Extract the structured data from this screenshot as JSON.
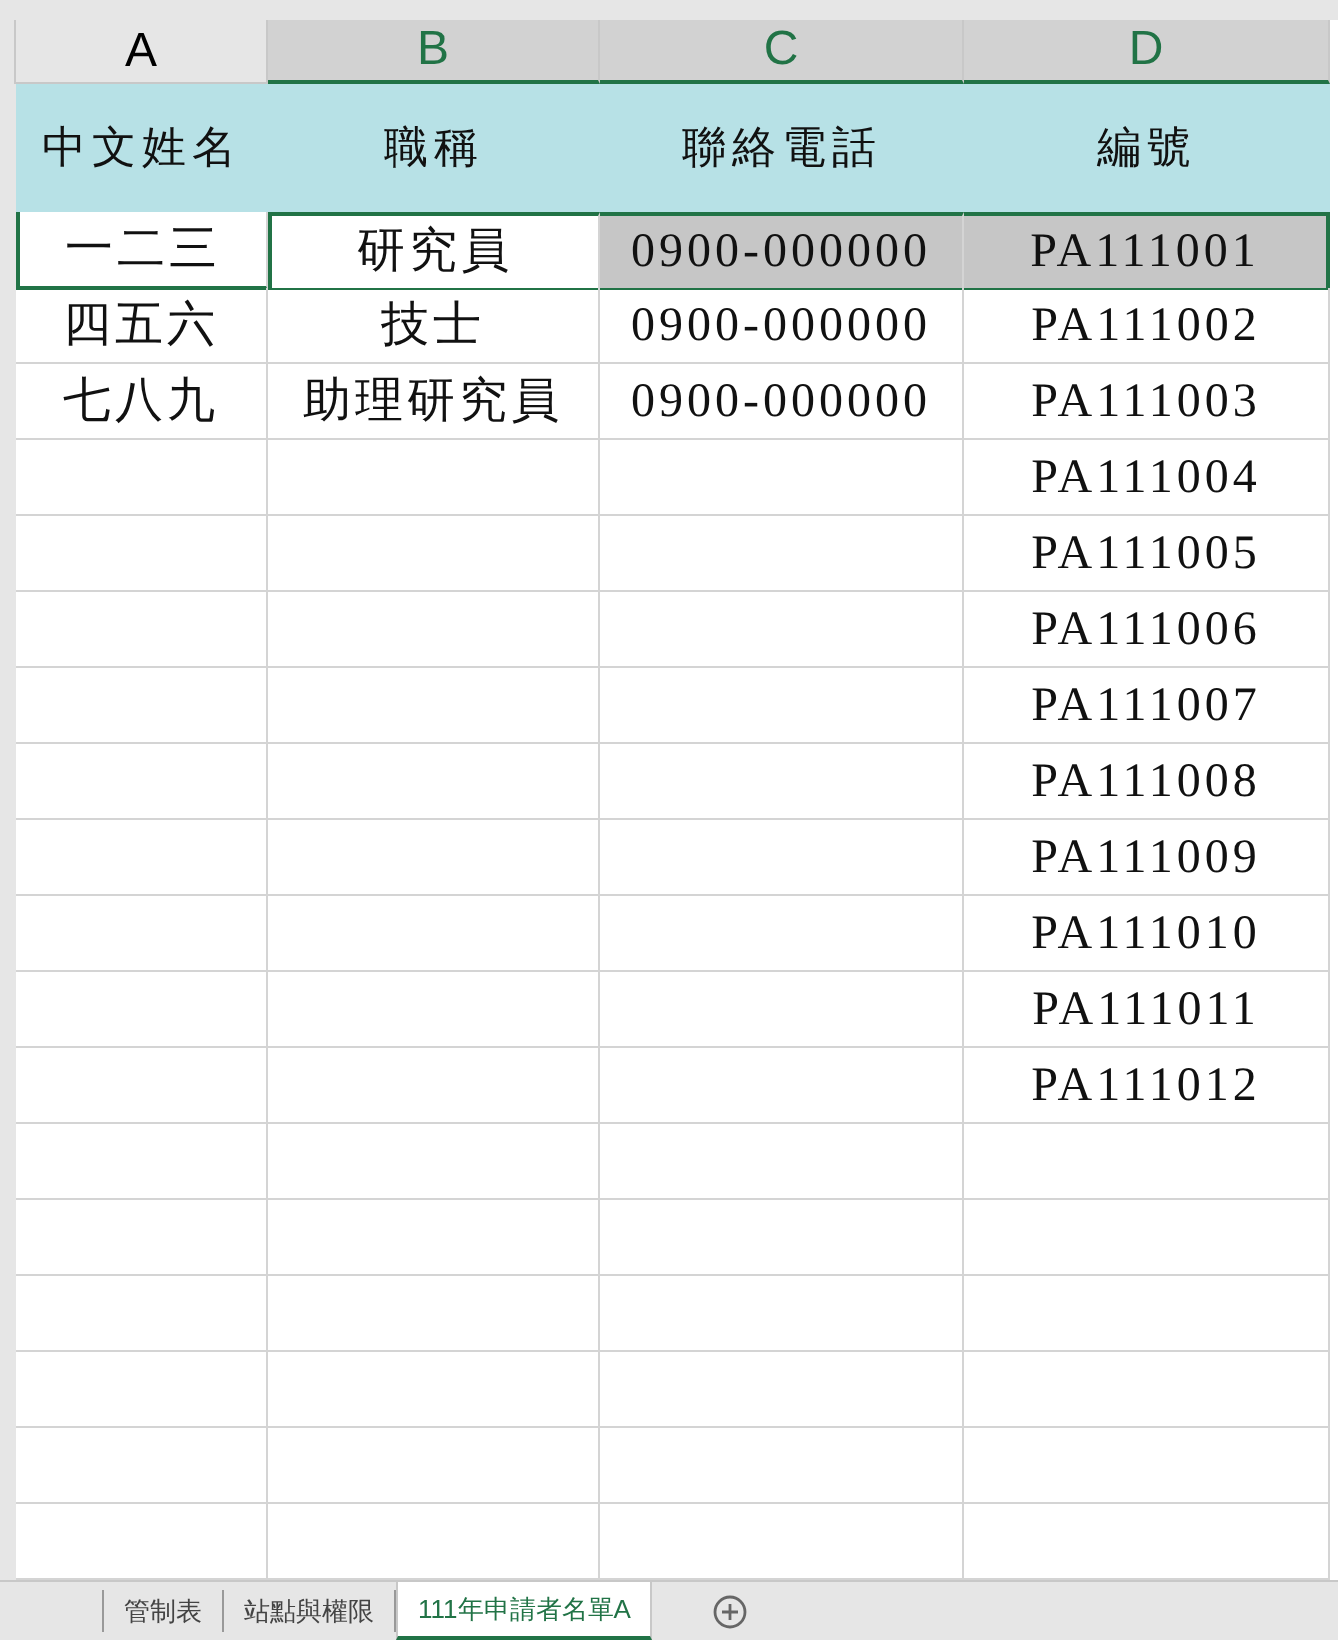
{
  "columns": [
    {
      "label": "A",
      "selected": false
    },
    {
      "label": "B",
      "selected": true
    },
    {
      "label": "C",
      "selected": true
    },
    {
      "label": "D",
      "selected": true
    }
  ],
  "header_row": [
    "中文姓名",
    "職稱",
    "聯絡電話",
    "編號"
  ],
  "rows": [
    {
      "name": "一二三",
      "title": "研究員",
      "phone": "0900-000000",
      "number": "PA111001",
      "selected": true
    },
    {
      "name": "四五六",
      "title": "技士",
      "phone": "0900-000000",
      "number": "PA111002",
      "selected": false
    },
    {
      "name": "七八九",
      "title": "助理研究員",
      "phone": "0900-000000",
      "number": "PA111003",
      "selected": false
    },
    {
      "number": "PA111004",
      "selected": false
    },
    {
      "number": "PA111005",
      "selected": false
    },
    {
      "number": "PA111006",
      "selected": false
    },
    {
      "number": "PA111007",
      "selected": false
    },
    {
      "number": "PA111008",
      "selected": false
    },
    {
      "number": "PA111009",
      "selected": false
    },
    {
      "number": "PA111010",
      "selected": false
    },
    {
      "number": "PA111011",
      "selected": false
    },
    {
      "number": "PA111012",
      "selected": false
    }
  ],
  "sheet_tabs": [
    {
      "label": "管制表",
      "selected": false
    },
    {
      "label": "站點與權限",
      "selected": false
    },
    {
      "label": "111年申請者名單A",
      "selected": true
    }
  ]
}
